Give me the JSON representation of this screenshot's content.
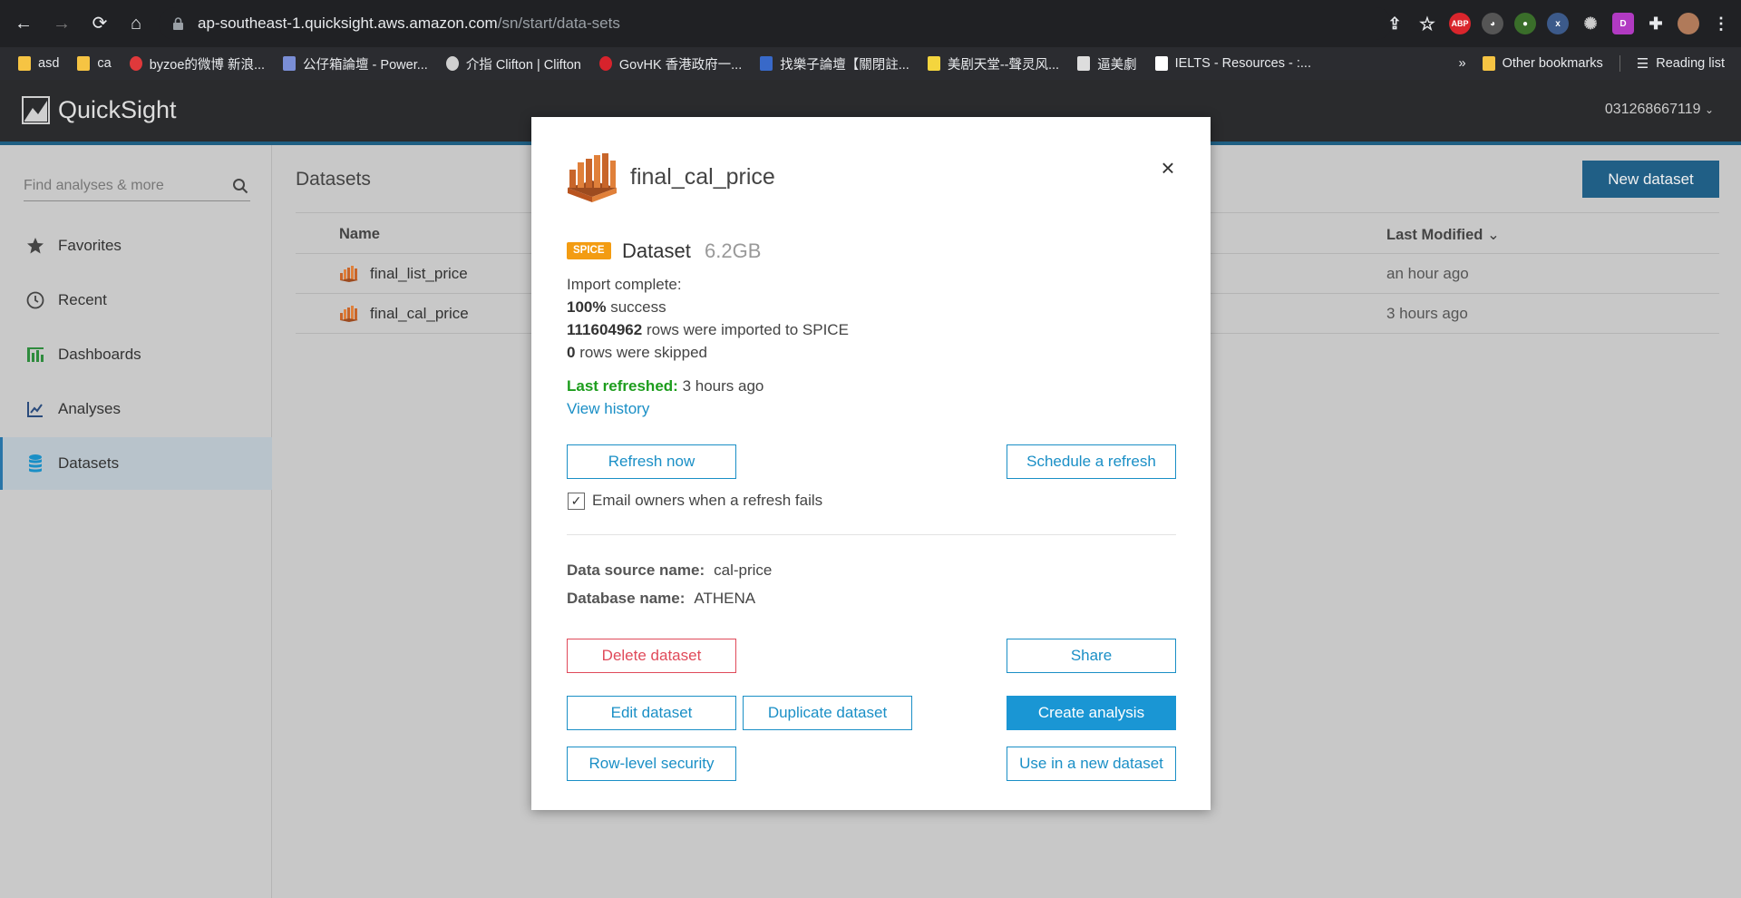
{
  "browser": {
    "url_host": "ap-southeast-1.quicksight.aws.amazon.com",
    "url_path": "/sn/start/data-sets",
    "extensions": [
      "ABP",
      "D"
    ],
    "bookmarks": [
      {
        "label": "asd",
        "color": "#f6c443"
      },
      {
        "label": "ca",
        "color": "#f6c443"
      },
      {
        "label": "byzoe的微博 新浪...",
        "color": "#e0393b"
      },
      {
        "label": "公仔箱論壇 - Power...",
        "color": "#7a8ed6"
      },
      {
        "label": "介指 Clifton | Clifton",
        "color": "#cfcfcf"
      },
      {
        "label": "GovHK 香港政府一...",
        "color": "#d7232c"
      },
      {
        "label": "找樂子論壇【關閉註...",
        "color": "#3869c9"
      },
      {
        "label": "美剧天堂--聲灵风...",
        "color": "#f4d53e"
      },
      {
        "label": "逼美劇",
        "color": "#dddddd"
      },
      {
        "label": "IELTS - Resources - :...",
        "color": "#ffffff"
      }
    ],
    "overflow": "»",
    "other_bookmarks": "Other bookmarks",
    "reading_list": "Reading list"
  },
  "app": {
    "name": "QuickSight",
    "account": "031268667119"
  },
  "sidebar": {
    "search_placeholder": "Find analyses & more",
    "items": [
      {
        "label": "Favorites",
        "icon": "star-icon"
      },
      {
        "label": "Recent",
        "icon": "clock-icon"
      },
      {
        "label": "Dashboards",
        "icon": "dashboard-icon"
      },
      {
        "label": "Analyses",
        "icon": "line-chart-icon"
      },
      {
        "label": "Datasets",
        "icon": "database-icon",
        "active": true
      }
    ]
  },
  "main": {
    "title": "Datasets",
    "new_dataset": "New dataset",
    "col_name": "Name",
    "col_modified": "Last Modified",
    "rows": [
      {
        "name": "final_list_price",
        "modified": "an hour ago"
      },
      {
        "name": "final_cal_price",
        "modified": "3 hours ago"
      }
    ]
  },
  "modal": {
    "title": "final_cal_price",
    "badge": "SPICE",
    "type_label": "Dataset",
    "size": "6.2GB",
    "import_status": "Import complete:",
    "success_pct": "100%",
    "success_text": "success",
    "rows_imported": "111604962",
    "rows_imported_text": "rows were imported to SPICE",
    "rows_skipped": "0",
    "rows_skipped_text": "rows were skipped",
    "last_refreshed_label": "Last refreshed:",
    "last_refreshed_value": "3 hours ago",
    "view_history": "View history",
    "refresh_now": "Refresh now",
    "schedule_refresh": "Schedule a refresh",
    "email_owners": "Email owners when a refresh fails",
    "email_checked": true,
    "data_source_label": "Data source name:",
    "data_source_value": "cal-price",
    "database_label": "Database name:",
    "database_value": "ATHENA",
    "delete": "Delete dataset",
    "share": "Share",
    "edit": "Edit dataset",
    "duplicate": "Duplicate dataset",
    "create_analysis": "Create analysis",
    "row_level_security": "Row-level security",
    "use_in_new_dataset": "Use in a new dataset",
    "close_glyph": "×",
    "check_glyph": "✓"
  },
  "colors": {
    "accent": "#1a8fc6",
    "primary": "#1a96d4",
    "danger": "#e04a5a",
    "spice": "#f39c12",
    "success": "#1d9d1d",
    "header": "#2a2b2d"
  }
}
